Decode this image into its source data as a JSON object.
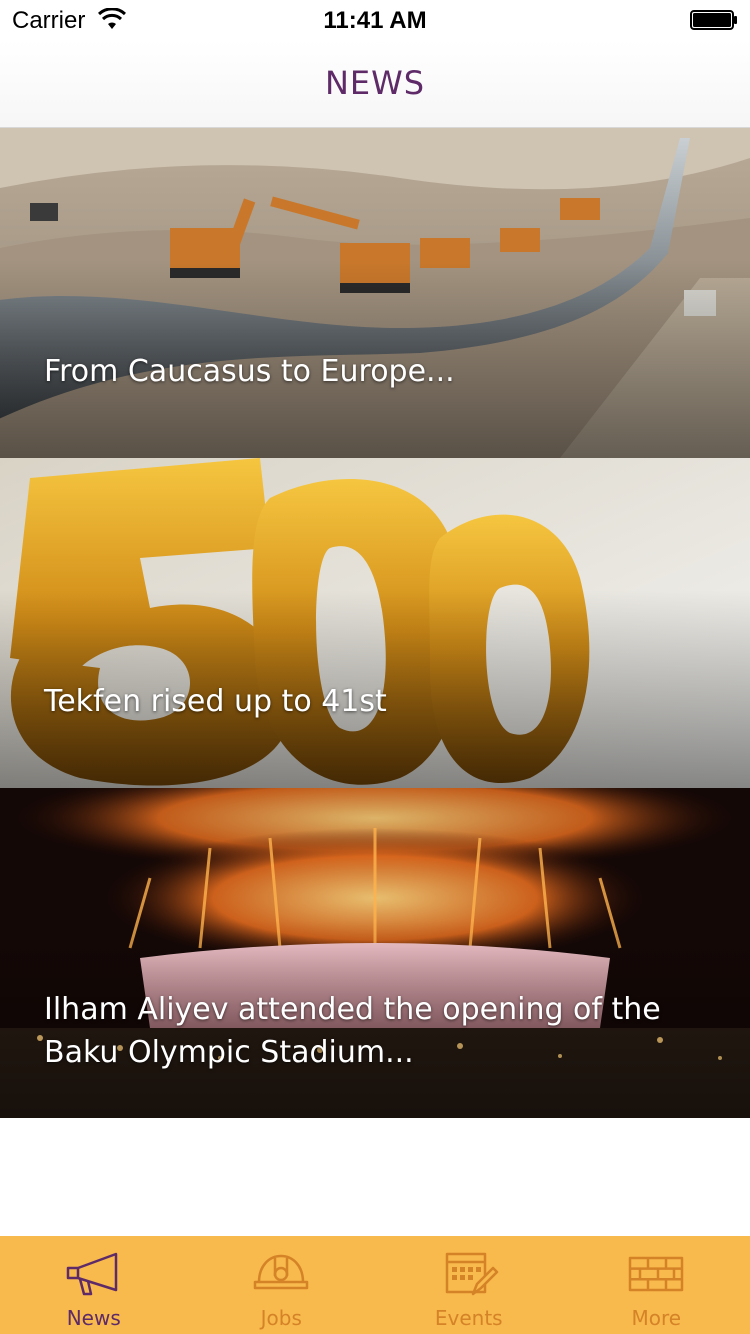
{
  "status_bar": {
    "carrier": "Carrier",
    "time": "11:41 AM"
  },
  "nav": {
    "title": "NEWS"
  },
  "news": [
    {
      "title": "From Caucasus to Europe..."
    },
    {
      "title": "Tekfen rised up to 41st"
    },
    {
      "title": "Ilham Aliyev attended the opening of the Baku Olympic Stadium..."
    }
  ],
  "tabs": [
    {
      "label": "News",
      "icon": "megaphone-icon",
      "active": true
    },
    {
      "label": "Jobs",
      "icon": "hard-hat-icon",
      "active": false
    },
    {
      "label": "Events",
      "icon": "calendar-icon",
      "active": false
    },
    {
      "label": "More",
      "icon": "brick-wall-icon",
      "active": false
    }
  ],
  "colors": {
    "accent": "#5e2b68",
    "tab_bar": "#f8b94d",
    "tab_inactive": "#d58327"
  }
}
